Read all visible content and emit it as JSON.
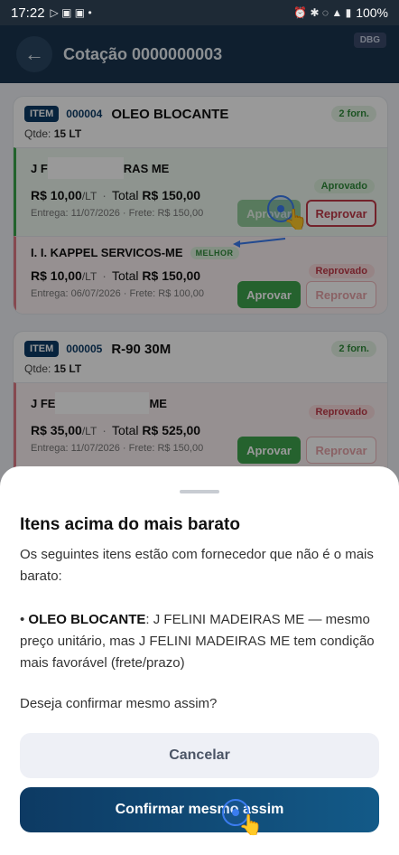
{
  "status_bar": {
    "time": "17:22",
    "battery": "100%"
  },
  "header": {
    "title": "Cotação 0000000003",
    "debug_badge": "DBG"
  },
  "items": [
    {
      "badge": "ITEM",
      "code": "000004",
      "name": "OLEO BLOCANTE",
      "suppliers_count": "2 forn.",
      "qtde_label": "Qtde:",
      "qtde_value": "15 LT",
      "suppliers": [
        {
          "name_prefix": "J F",
          "name_suffix": "RAS ME",
          "price": "R$ 10,00",
          "unit": "/LT",
          "total_label": "Total",
          "total": "R$ 150,00",
          "delivery": "Entrega: 11/07/2026 · Frete: R$ 150,00",
          "status": "Aprovado",
          "approve_label": "Aprovar",
          "reject_label": "Reprovar"
        },
        {
          "name": "I. I. KAPPEL SERVICOS-ME",
          "best_badge": "MELHOR",
          "price": "R$ 10,00",
          "unit": "/LT",
          "total_label": "Total",
          "total": "R$ 150,00",
          "delivery": "Entrega: 06/07/2026 · Frete: R$ 100,00",
          "status": "Reprovado",
          "approve_label": "Aprovar",
          "reject_label": "Reprovar"
        }
      ]
    },
    {
      "badge": "ITEM",
      "code": "000005",
      "name": "R-90 30M",
      "suppliers_count": "2 forn.",
      "qtde_label": "Qtde:",
      "qtde_value": "15 LT",
      "suppliers": [
        {
          "name_prefix": "J FE",
          "name_suffix": "ME",
          "price": "R$ 35,00",
          "unit": "/LT",
          "total_label": "Total",
          "total": "R$ 525,00",
          "delivery": "Entrega: 11/07/2026 · Frete: R$ 150,00",
          "status": "Reprovado",
          "approve_label": "Aprovar",
          "reject_label": "Reprovar"
        }
      ]
    }
  ],
  "dialog": {
    "title": "Itens acima do mais barato",
    "intro": "Os seguintes itens estão com fornecedor que não é o mais barato:",
    "bullet_item": "OLEO BLOCANTE",
    "bullet_text": ": J FELINI MADEIRAS ME — mesmo preço unitário, mas J FELINI MADEIRAS ME tem condição mais favorável (frete/prazo)",
    "question": "Deseja confirmar mesmo assim?",
    "cancel_label": "Cancelar",
    "confirm_label": "Confirmar mesmo assim"
  }
}
